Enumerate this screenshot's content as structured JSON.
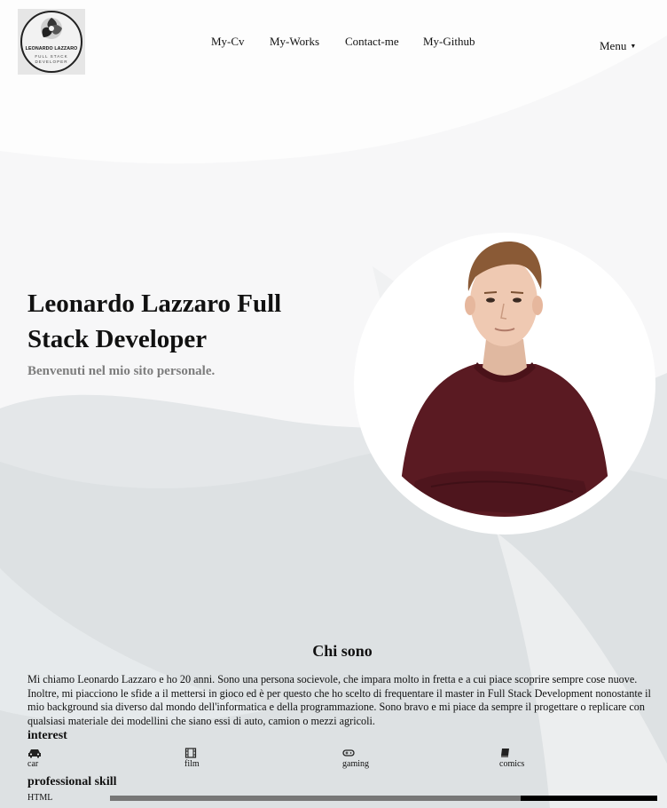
{
  "header": {
    "logo": {
      "name": "LEONARDO LAZZARO",
      "sub_line1": "FULL STACK",
      "sub_line2": "DEVELOPER"
    },
    "nav": [
      {
        "label": "My-Cv"
      },
      {
        "label": "My-Works"
      },
      {
        "label": "Contact-me"
      },
      {
        "label": "My-Github"
      }
    ],
    "menu_label": "Menu"
  },
  "hero": {
    "title": "Leonardo Lazzaro Full Stack Developer",
    "subtitle": "Benvenuti nel mio sito personale."
  },
  "about": {
    "title": "Chi sono",
    "text": "Mi chiamo Leonardo Lazzaro e ho 20 anni. Sono una persona socievole, che impara molto in fretta e a cui piace scoprire sempre cose nuove. Inoltre, mi piacciono le sfide a il mettersi in gioco ed è per questo che ho scelto di frequentare il master in Full Stack Development nonostante il mio background sia diverso dal mondo dell'informatica e della programmazione. Sono bravo e mi piace da sempre il progettare o replicare con qualsiasi materiale dei modellini che siano essi di auto, camion o mezzi agricoli."
  },
  "interests": {
    "title": "interest",
    "items": [
      {
        "label": "car",
        "icon": "car-icon"
      },
      {
        "label": "film",
        "icon": "film-icon"
      },
      {
        "label": "gaming",
        "icon": "gamepad-icon"
      },
      {
        "label": "comics",
        "icon": "book-icon"
      }
    ]
  },
  "skills": {
    "title": "professional skill",
    "items": [
      {
        "label": "HTML",
        "level": 0.75
      }
    ]
  },
  "colors": {
    "subtitle_gray": "#7d7d7d",
    "sweater": "#5a1a22",
    "bar_track": "#000000",
    "bar_fill": "#777777"
  }
}
